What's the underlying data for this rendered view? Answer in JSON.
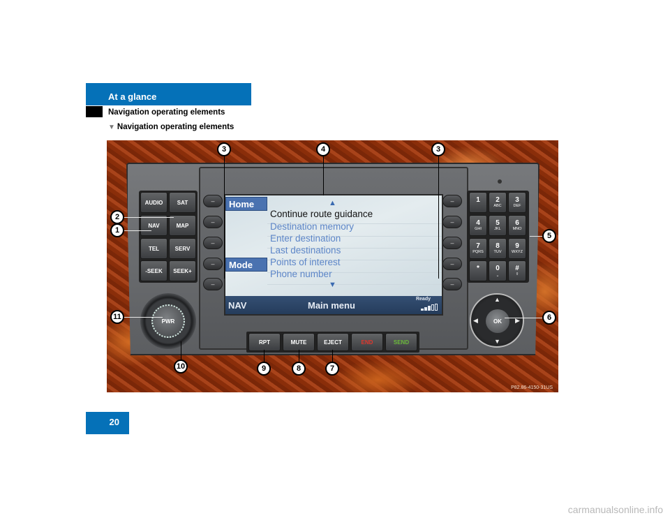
{
  "header": {
    "section_tab": "At a glance",
    "section_title": "Navigation operating elements",
    "subsection_marker": "▼",
    "subsection_title": "Navigation operating elements"
  },
  "left_buttons": [
    "AUDIO",
    "SAT",
    "NAV",
    "MAP",
    "TEL",
    "SERV",
    "-SEEK",
    "SEEK+"
  ],
  "soft_key_glyph": "–",
  "screen": {
    "tab_home": "Home",
    "tab_mode": "Mode",
    "scroll_up": "▲",
    "scroll_down": "▼",
    "menu_items": [
      {
        "label": "Continue route guidance",
        "active": true
      },
      {
        "label": "Destination memory",
        "active": false
      },
      {
        "label": "Enter destination",
        "active": false
      },
      {
        "label": "Last destinations",
        "active": false
      },
      {
        "label": "Points of interest",
        "active": false
      },
      {
        "label": "Phone number",
        "active": false
      }
    ],
    "status_mode": "NAV",
    "status_title": "Main menu",
    "status_ready": "Ready",
    "signal_bars_filled": 3,
    "signal_bars_total": 5
  },
  "keypad": [
    {
      "n": "1",
      "l": ""
    },
    {
      "n": "2",
      "l": "ABC"
    },
    {
      "n": "3",
      "l": "DEF"
    },
    {
      "n": "4",
      "l": "GHI"
    },
    {
      "n": "5",
      "l": "JKL"
    },
    {
      "n": "6",
      "l": "MNO"
    },
    {
      "n": "7",
      "l": "PQRS"
    },
    {
      "n": "8",
      "l": "TUV"
    },
    {
      "n": "9",
      "l": "WXYZ"
    },
    {
      "n": "*",
      "l": ""
    },
    {
      "n": "0",
      "l": "⎵"
    },
    {
      "n": "#",
      "l": "⇧"
    }
  ],
  "knob_label": "PWR",
  "ok_label": "OK",
  "bottom_buttons": [
    {
      "label": "RPT",
      "color": "#ffffff"
    },
    {
      "label": "MUTE",
      "color": "#ffffff"
    },
    {
      "label": "EJECT",
      "color": "#ffffff"
    },
    {
      "label": "END",
      "color": "#e0362c"
    },
    {
      "label": "SEND",
      "color": "#6ab83a"
    }
  ],
  "callouts": [
    "1",
    "2",
    "3",
    "3",
    "4",
    "5",
    "6",
    "7",
    "8",
    "9",
    "10",
    "11"
  ],
  "image_code": "P82.86-4150-31US",
  "page_number": "20",
  "watermark": "carmanualsonline.info"
}
